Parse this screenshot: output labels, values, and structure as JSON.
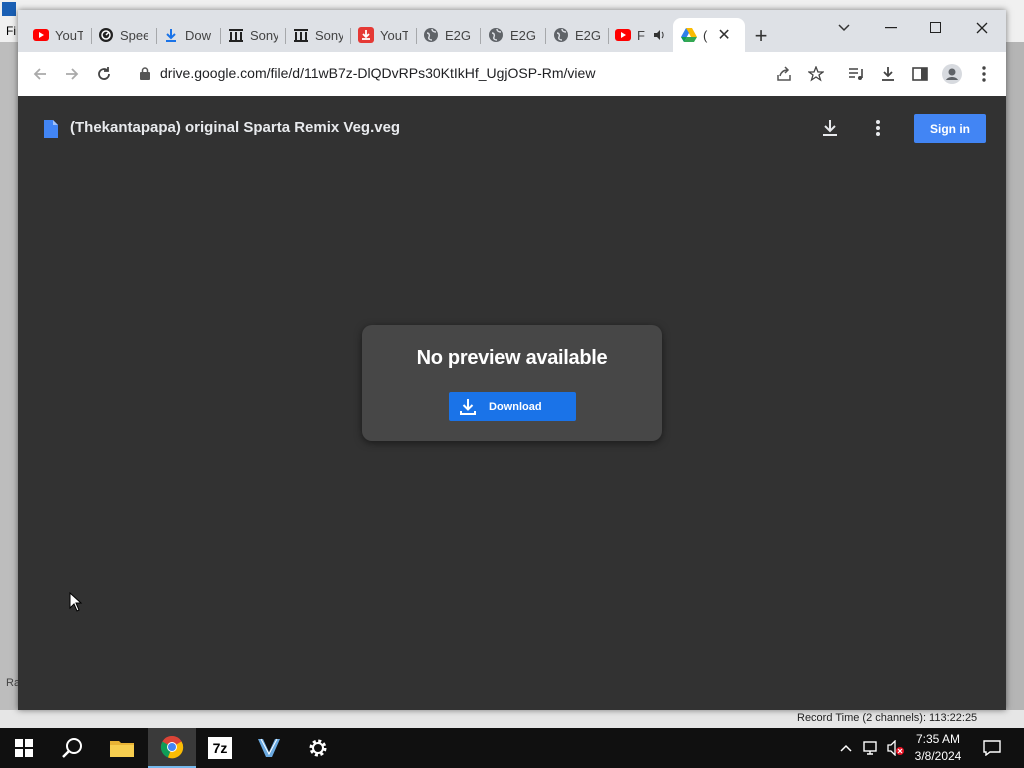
{
  "background_app": {
    "menu_first": "Fi",
    "record_time": "Record Time (2 channels): 113:22:25",
    "side_label": "Ra"
  },
  "browser": {
    "tabs": [
      {
        "label": "YouT",
        "icon": "youtube-icon"
      },
      {
        "label": "Spee",
        "icon": "speed-icon"
      },
      {
        "label": "Dow",
        "icon": "download-icon"
      },
      {
        "label": "Sony",
        "icon": "archive-icon"
      },
      {
        "label": "Sony",
        "icon": "archive-icon"
      },
      {
        "label": "YouT",
        "icon": "downloader-icon"
      },
      {
        "label": "E2G",
        "icon": "globe-icon"
      },
      {
        "label": "E2G",
        "icon": "globe-icon"
      },
      {
        "label": "E2G",
        "icon": "globe-icon"
      },
      {
        "label": "F",
        "icon": "youtube-icon"
      }
    ],
    "active_tab": {
      "label": "(",
      "icon": "google-drive-icon"
    },
    "url": "drive.google.com/file/d/11wB7z-DlQDvRPs30KtIkHf_UgjOSP-Rm/view"
  },
  "viewer": {
    "filename": "(Thekantapapa) original Sparta Remix Veg.veg",
    "sign_in": "Sign in",
    "no_preview": "No preview available",
    "download": "Download"
  },
  "taskbar": {
    "time": "7:35 AM",
    "date": "3/8/2024",
    "apps": [
      "start-icon",
      "search-icon",
      "file-explorer-icon",
      "chrome-icon",
      "7zip-icon",
      "vegas-icon",
      "settings-icon"
    ],
    "sevenzip_label": "7z"
  },
  "colors": {
    "accent": "#4285f4",
    "download_button": "#1a73e8",
    "viewer_bg": "#323232",
    "card_bg": "#474747"
  }
}
